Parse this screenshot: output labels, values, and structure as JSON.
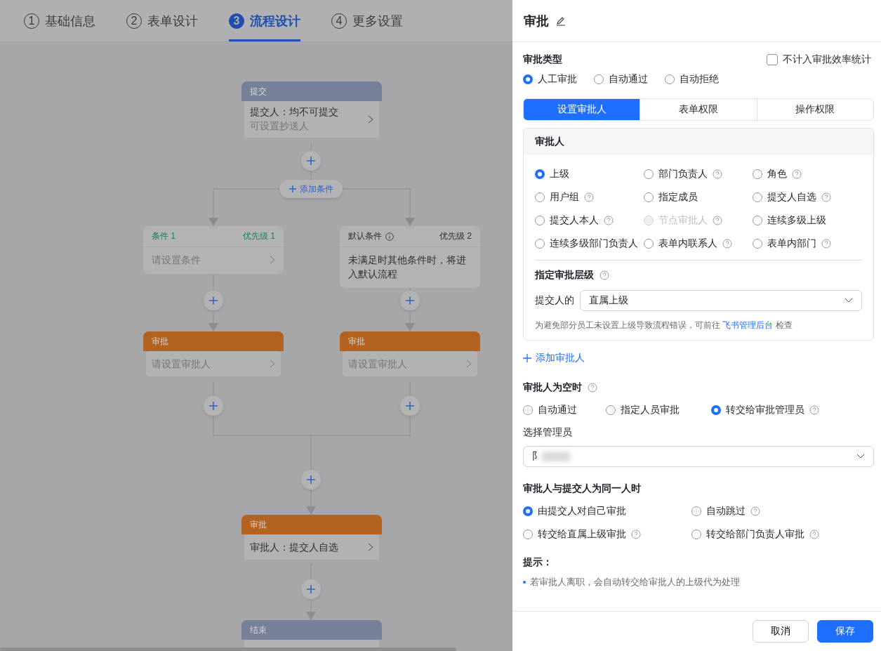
{
  "steps": [
    {
      "num": "1",
      "label": "基础信息",
      "selected": false
    },
    {
      "num": "2",
      "label": "表单设计",
      "selected": false
    },
    {
      "num": "3",
      "label": "流程设计",
      "selected": true
    },
    {
      "num": "4",
      "label": "更多设置",
      "selected": false
    }
  ],
  "flow": {
    "start": {
      "kind": "submit",
      "title": "提交",
      "value": "提交人：均不可提交",
      "sub": "可设置抄送人"
    },
    "add_condition": "添加条件",
    "branches": [
      {
        "condition": {
          "kind": "condition",
          "title": "条件 1",
          "priority": "优先级 1",
          "info": false,
          "placeholder": "请设置条件"
        },
        "approver": {
          "kind": "approval",
          "title": "审批",
          "placeholder": "请设置审批人"
        }
      },
      {
        "condition": {
          "kind": "default",
          "title": "默认条件",
          "priority": "优先级 2",
          "info": true,
          "text": "未满足时其他条件时，将进入默认流程"
        },
        "approver": {
          "kind": "approval",
          "title": "审批",
          "placeholder": "请设置审批人"
        }
      }
    ],
    "after": [
      {
        "kind": "approval",
        "title": "审批",
        "value": "审批人：提交人自选"
      },
      {
        "kind": "end",
        "title": "结束"
      }
    ]
  },
  "panel": {
    "title": "审批",
    "approval_type": {
      "label": "审批类型",
      "exclude": {
        "label": "不计入审批效率统计",
        "checked": false
      },
      "options": [
        {
          "label": "人工审批",
          "selected": true
        },
        {
          "label": "自动通过",
          "selected": false
        },
        {
          "label": "自动拒绝",
          "selected": false
        }
      ]
    },
    "tabs": [
      {
        "label": "设置审批人",
        "selected": true
      },
      {
        "label": "表单权限",
        "selected": false
      },
      {
        "label": "操作权限",
        "selected": false
      }
    ],
    "approver": {
      "title": "审批人",
      "options": [
        {
          "label": "上级",
          "selected": true,
          "help": false,
          "disabled": false
        },
        {
          "label": "部门负责人",
          "selected": false,
          "help": true,
          "disabled": false
        },
        {
          "label": "角色",
          "selected": false,
          "help": true,
          "disabled": false
        },
        {
          "label": "用户组",
          "selected": false,
          "help": true,
          "disabled": false
        },
        {
          "label": "指定成员",
          "selected": false,
          "help": false,
          "disabled": false
        },
        {
          "label": "提交人自选",
          "selected": false,
          "help": true,
          "disabled": false
        },
        {
          "label": "提交人本人",
          "selected": false,
          "help": true,
          "disabled": false
        },
        {
          "label": "节点审批人",
          "selected": false,
          "help": true,
          "disabled": true
        },
        {
          "label": "连续多级上级",
          "selected": false,
          "help": false,
          "disabled": false
        },
        {
          "label": "连续多级部门负责人",
          "selected": false,
          "help": false,
          "disabled": false
        },
        {
          "label": "表单内联系人",
          "selected": false,
          "help": true,
          "disabled": false
        },
        {
          "label": "表单内部门",
          "selected": false,
          "help": true,
          "disabled": false
        }
      ],
      "level_title": "指定审批层级",
      "level_prefix": "提交人的",
      "level_value": "直属上级",
      "hint": "为避免部分员工未设置上级导致流程错误，可前往",
      "hint_link": "飞书管理后台",
      "hint_after": "检查"
    },
    "add_approver": "添加审批人",
    "empty": {
      "title": "审批人为空时",
      "options": [
        {
          "label": "自动通过",
          "selected": false,
          "help": false
        },
        {
          "label": "指定人员审批",
          "selected": false,
          "help": false
        },
        {
          "label": "转交给审批管理员",
          "selected": true,
          "help": true
        }
      ],
      "admin_label": "选择管理员",
      "admin_value": "阝"
    },
    "same": {
      "title": "审批人与提交人为同一人时",
      "options": [
        {
          "label": "由提交人对自己审批",
          "selected": true,
          "help": false
        },
        {
          "label": "自动跳过",
          "selected": false,
          "help": true
        },
        {
          "label": "转交给直属上级审批",
          "selected": false,
          "help": true
        },
        {
          "label": "转交给部门负责人审批",
          "selected": false,
          "help": true
        }
      ]
    },
    "tips": {
      "title": "提示：",
      "items": [
        "若审批人离职，会自动转交给审批人的上级代为处理"
      ]
    },
    "buttons": [
      {
        "label": "取消",
        "kind": "default"
      },
      {
        "label": "保存",
        "kind": "primary"
      }
    ]
  }
}
